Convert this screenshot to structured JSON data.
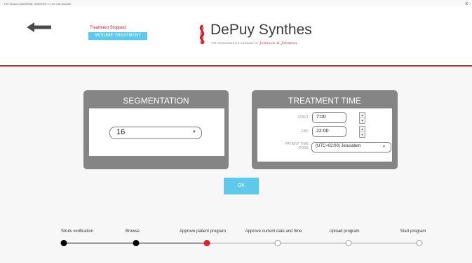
{
  "window": {
    "title": "FW Version 6450R008, SoftVERS 1.7.50 / All Smartie",
    "close_symbol": "x"
  },
  "header": {
    "back_icon": "arrow-left-icon",
    "status_text": "Treatment Stopped",
    "resume_label": "RESUME TREATMENT",
    "brand_name": "DePuy Synthes",
    "brand_tagline": "THE ORTHOPAEDICS COMPANY OF",
    "brand_parent": "Johnson & Johnson",
    "accent_color": "#c9222f",
    "button_color": "#5ec9ea"
  },
  "segmentation": {
    "title": "SEGMENTATION",
    "selected": "16"
  },
  "treatment_time": {
    "title": "TREATMENT TIME",
    "start_label": "START",
    "start_value": "7:00",
    "end_label": "END",
    "end_value": "22:00",
    "timezone_label_1": "PATIENT TIME",
    "timezone_label_2": "ZONE",
    "timezone_value": "(UTC+02:00) Jerusalem"
  },
  "ok_label": "OK",
  "steps": [
    {
      "label": "Struts verification",
      "state": "done"
    },
    {
      "label": "Browse",
      "state": "done"
    },
    {
      "label": "Approve patient program",
      "state": "current"
    },
    {
      "label": "Approve current date and time",
      "state": "pending"
    },
    {
      "label": "Upload program",
      "state": "pending"
    },
    {
      "label": "Start program",
      "state": "pending"
    }
  ]
}
